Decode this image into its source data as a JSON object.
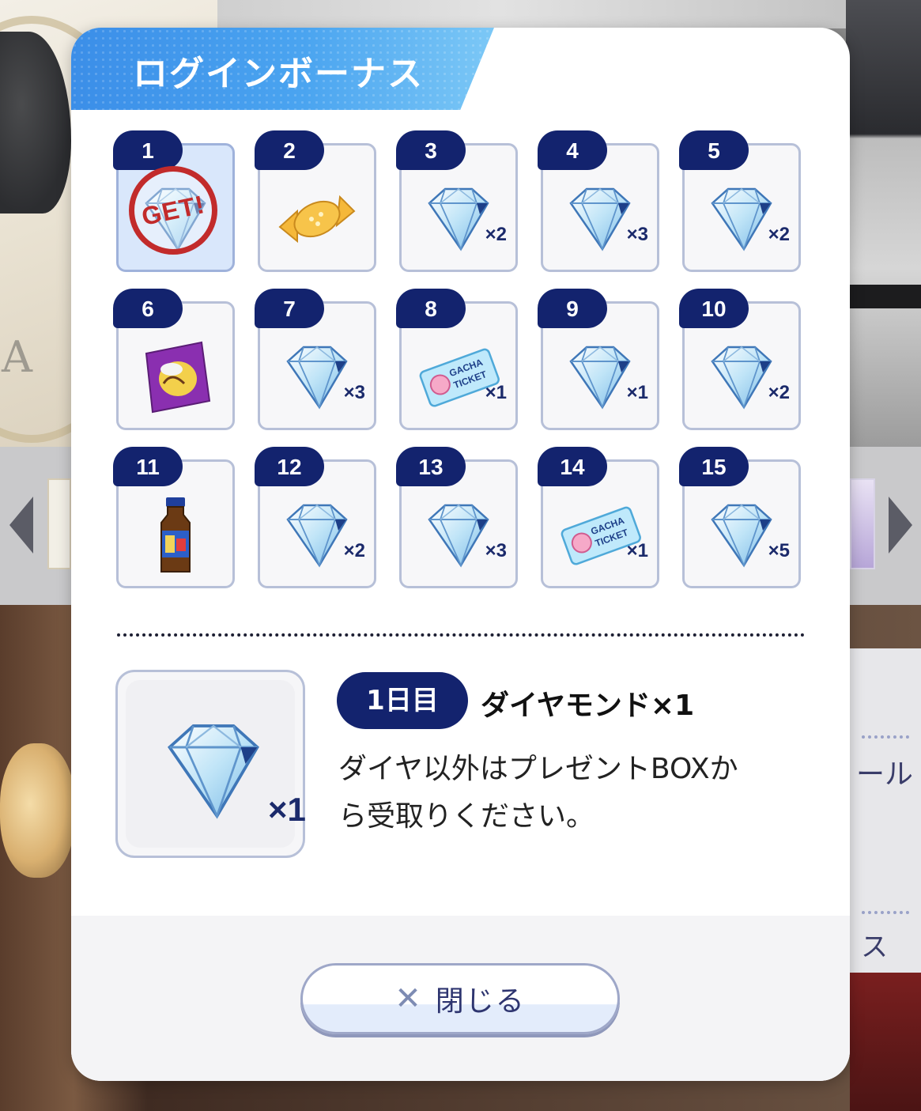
{
  "modal": {
    "title": "ログインボーナス",
    "close_label": "閉じる"
  },
  "days": [
    {
      "day": "1",
      "item": "diamond",
      "qty": "",
      "claimed": true,
      "stamp": "GET!"
    },
    {
      "day": "2",
      "item": "candy",
      "qty": ""
    },
    {
      "day": "3",
      "item": "diamond",
      "qty": "×2"
    },
    {
      "day": "4",
      "item": "diamond",
      "qty": "×3"
    },
    {
      "day": "5",
      "item": "diamond",
      "qty": "×2"
    },
    {
      "day": "6",
      "item": "chips",
      "qty": ""
    },
    {
      "day": "7",
      "item": "diamond",
      "qty": "×3"
    },
    {
      "day": "8",
      "item": "gacha-ticket",
      "qty": "×1"
    },
    {
      "day": "9",
      "item": "diamond",
      "qty": "×1"
    },
    {
      "day": "10",
      "item": "diamond",
      "qty": "×2"
    },
    {
      "day": "11",
      "item": "drink",
      "qty": ""
    },
    {
      "day": "12",
      "item": "diamond",
      "qty": "×2"
    },
    {
      "day": "13",
      "item": "diamond",
      "qty": "×3"
    },
    {
      "day": "14",
      "item": "gacha-ticket",
      "qty": "×1"
    },
    {
      "day": "15",
      "item": "diamond",
      "qty": "×5"
    }
  ],
  "selected": {
    "day_label": "1日目",
    "reward_name": "ダイヤモンド×1",
    "qty": "×1",
    "note_line1": "ダイヤ以外はプレゼントBOXか",
    "note_line2": "ら受取りください。"
  },
  "background": {
    "left_letter": "A",
    "right_text_1": "ール",
    "right_text_2": "ス"
  },
  "colors": {
    "accent_navy": "#13236e",
    "title_blue": "#3b8ee8",
    "stamp_red": "#c22b2b"
  }
}
